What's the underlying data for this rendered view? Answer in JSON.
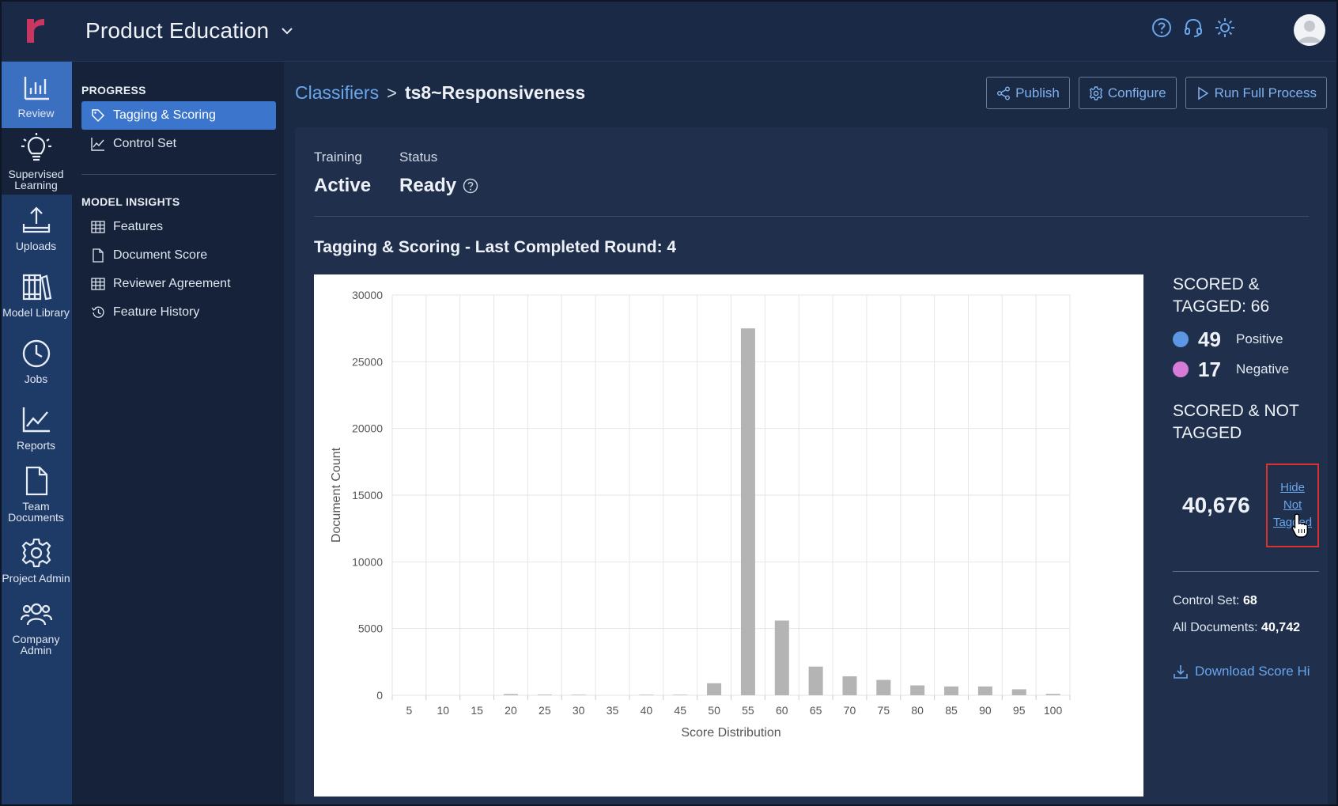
{
  "header": {
    "workspace_name": "Product Education",
    "icons": [
      "help-icon",
      "headset-icon",
      "sun-icon",
      "user-avatar"
    ]
  },
  "left_nav": {
    "items": [
      {
        "id": "review",
        "label": "Review",
        "icon": "bar-chart-icon"
      },
      {
        "id": "supervised-learning",
        "label": "Supervised Learning",
        "icon": "lightbulb-icon"
      },
      {
        "id": "uploads",
        "label": "Uploads",
        "icon": "upload-icon"
      },
      {
        "id": "model-library",
        "label": "Model Library",
        "icon": "library-icon"
      },
      {
        "id": "jobs",
        "label": "Jobs",
        "icon": "clock-icon"
      },
      {
        "id": "reports",
        "label": "Reports",
        "icon": "line-chart-icon"
      },
      {
        "id": "team-documents",
        "label": "Team Documents",
        "icon": "document-icon"
      },
      {
        "id": "project-admin",
        "label": "Project Admin",
        "icon": "gear-icon"
      },
      {
        "id": "company-admin",
        "label": "Company Admin",
        "icon": "users-icon"
      }
    ]
  },
  "sub_nav": {
    "progress_title": "PROGRESS",
    "progress_items": [
      {
        "label": "Tagging & Scoring",
        "icon": "tag-icon",
        "selected": true
      },
      {
        "label": "Control Set",
        "icon": "trend-icon",
        "selected": false
      }
    ],
    "insights_title": "MODEL INSIGHTS",
    "insights_items": [
      {
        "label": "Features",
        "icon": "table-icon"
      },
      {
        "label": "Document Score",
        "icon": "file-icon"
      },
      {
        "label": "Reviewer Agreement",
        "icon": "table-icon"
      },
      {
        "label": "Feature History",
        "icon": "history-icon"
      }
    ]
  },
  "breadcrumb": {
    "parent": "Classifiers",
    "separator": ">",
    "current": "ts8~Responsiveness"
  },
  "actions": {
    "publish": "Publish",
    "configure": "Configure",
    "run_full_process": "Run Full Process"
  },
  "status": {
    "training_label": "Training",
    "training_value": "Active",
    "status_label": "Status",
    "status_value": "Ready"
  },
  "section_title": "Tagging & Scoring - Last Completed Round: 4",
  "chart_data": {
    "type": "bar",
    "title": "",
    "xlabel": "Score Distribution",
    "ylabel": "Document Count",
    "categories": [
      "5",
      "10",
      "15",
      "20",
      "25",
      "30",
      "35",
      "40",
      "45",
      "50",
      "55",
      "60",
      "65",
      "70",
      "75",
      "80",
      "85",
      "90",
      "95",
      "100"
    ],
    "values": [
      0,
      0,
      0,
      90,
      50,
      40,
      0,
      40,
      40,
      900,
      27500,
      5600,
      2150,
      1420,
      1150,
      740,
      660,
      660,
      450,
      100
    ],
    "ylim": [
      0,
      30000
    ],
    "yticks": [
      0,
      5000,
      10000,
      15000,
      20000,
      25000,
      30000
    ],
    "grid": true,
    "bar_color": "#b4b4b4"
  },
  "summary": {
    "scored_tagged_heading": "SCORED & TAGGED: 66",
    "positive_count": "49",
    "positive_label": "Positive",
    "positive_color": "#5b97e3",
    "negative_count": "17",
    "negative_label": "Negative",
    "negative_color": "#d77bd9",
    "scored_not_tagged_heading": "SCORED & NOT TAGGED",
    "not_tagged_count": "40,676",
    "hide_link_words": [
      "Hide",
      "Not",
      "Tagged"
    ],
    "control_set_label": "Control Set:",
    "control_set_value": "68",
    "all_documents_label": "All Documents:",
    "all_documents_value": "40,742",
    "download_label": "Download Score Hi"
  }
}
